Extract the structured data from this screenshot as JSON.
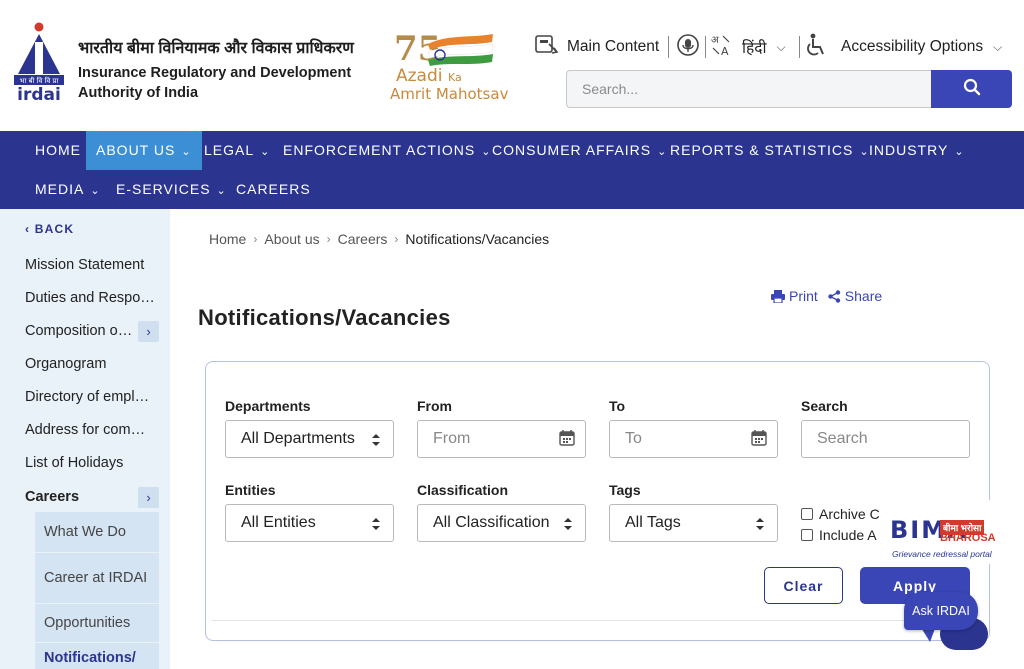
{
  "header": {
    "org_name_hindi": "भारतीय बीमा विनियामक और विकास प्राधिकरण",
    "org_name_line1": "Insurance Regulatory and Development",
    "org_name_line2": "Authority of India",
    "logo_text": "irdai",
    "azadi_line1": "Azadi",
    "azadi_ka": "Ka",
    "azadi_line2": "Amrit Mahotsav",
    "azadi_75": "75",
    "utils": {
      "main_content": "Main Content",
      "language": "हिंदी",
      "accessibility": "Accessibility Options"
    },
    "search": {
      "placeholder": "Search..."
    }
  },
  "nav": {
    "items": [
      {
        "label": "HOME",
        "active": false,
        "dropdown": false
      },
      {
        "label": "ABOUT US",
        "active": true,
        "dropdown": true
      },
      {
        "label": "LEGAL",
        "active": false,
        "dropdown": true
      },
      {
        "label": "ENFORCEMENT ACTIONS",
        "active": false,
        "dropdown": true
      },
      {
        "label": "CONSUMER AFFAIRS",
        "active": false,
        "dropdown": true
      },
      {
        "label": "REPORTS & STATISTICS",
        "active": false,
        "dropdown": true
      },
      {
        "label": "INDUSTRY",
        "active": false,
        "dropdown": true
      },
      {
        "label": "MEDIA",
        "active": false,
        "dropdown": true
      },
      {
        "label": "E-SERVICES",
        "active": false,
        "dropdown": true
      },
      {
        "label": "CAREERS",
        "active": false,
        "dropdown": false
      }
    ]
  },
  "sidebar": {
    "back_label": "BACK",
    "items": [
      {
        "label": "Mission Statement"
      },
      {
        "label": "Duties and Responsibilities"
      },
      {
        "label": "Composition of the Authority"
      },
      {
        "label": "Organogram"
      },
      {
        "label": "Directory of employees"
      },
      {
        "label": "Address for communication"
      },
      {
        "label": "List of Holidays"
      },
      {
        "label": "Careers"
      }
    ],
    "sub_items": [
      {
        "label": "What We Do"
      },
      {
        "label": "Career at IRDAI"
      },
      {
        "label": "Opportunities"
      },
      {
        "label": "Notifications/"
      }
    ]
  },
  "breadcrumb": {
    "items": [
      "Home",
      "About us",
      "Careers",
      "Notifications/Vacancies"
    ]
  },
  "actions": {
    "print": "Print",
    "share": "Share"
  },
  "page": {
    "title": "Notifications/Vacancies"
  },
  "filters": {
    "departments": {
      "label": "Departments",
      "value": "All Departments"
    },
    "from": {
      "label": "From",
      "placeholder": "From"
    },
    "to": {
      "label": "To",
      "placeholder": "To"
    },
    "search": {
      "label": "Search",
      "placeholder": "Search"
    },
    "entities": {
      "label": "Entities",
      "value": "All Entities"
    },
    "classification": {
      "label": "Classification",
      "value": "All Classification"
    },
    "tags": {
      "label": "Tags",
      "value": "All Tags"
    },
    "archive_label": "Archive C",
    "include_label": "Include A",
    "clear_label": "Clear",
    "apply_label": "Apply"
  },
  "bima_bharosa": {
    "title": "BIMA",
    "hindi": "बीमा भरोसा",
    "bharosa": "BHAROSA",
    "tagline": "Grievance redressal portal"
  },
  "ask_irdai": {
    "label": "Ask IRDAI"
  },
  "colors": {
    "primary": "#2b3590",
    "nav_active": "#3d8fd5",
    "sidebar_bg": "#e9f1f9",
    "button": "#3a46b6"
  }
}
